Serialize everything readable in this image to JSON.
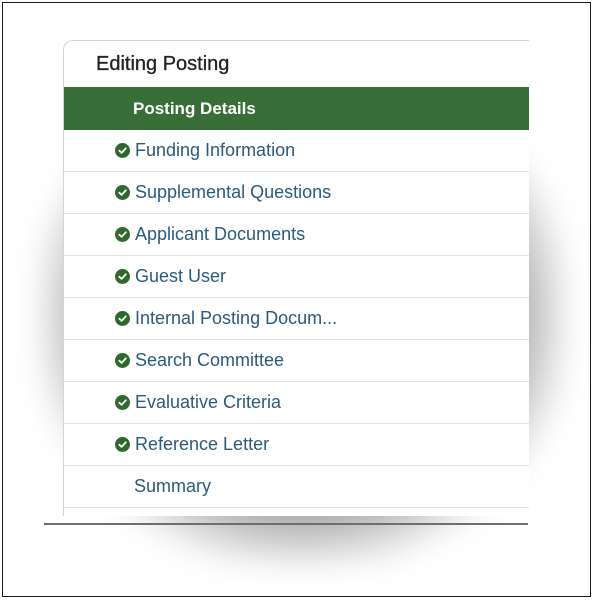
{
  "panel": {
    "title": "Editing Posting"
  },
  "nav": {
    "items": [
      {
        "label": "Posting Details",
        "state": "active",
        "icon": "none"
      },
      {
        "label": "Funding Information",
        "state": "complete",
        "icon": "check-circle-icon"
      },
      {
        "label": "Supplemental Questions",
        "state": "complete",
        "icon": "check-circle-icon"
      },
      {
        "label": "Applicant Documents",
        "state": "complete",
        "icon": "check-circle-icon"
      },
      {
        "label": "Guest User",
        "state": "complete",
        "icon": "check-circle-icon"
      },
      {
        "label": "Internal Posting Docum...",
        "state": "complete",
        "icon": "check-circle-icon"
      },
      {
        "label": "Search Committee",
        "state": "complete",
        "icon": "check-circle-icon"
      },
      {
        "label": "Evaluative Criteria",
        "state": "complete",
        "icon": "check-circle-icon"
      },
      {
        "label": "Reference Letter",
        "state": "complete",
        "icon": "check-circle-icon"
      },
      {
        "label": "Summary",
        "state": "plain",
        "icon": "none"
      }
    ]
  },
  "colors": {
    "active_bg": "#3a6e38",
    "active_text": "#ffffff",
    "link_text": "#2a5a7e",
    "check_icon": "#2f6a2c"
  }
}
